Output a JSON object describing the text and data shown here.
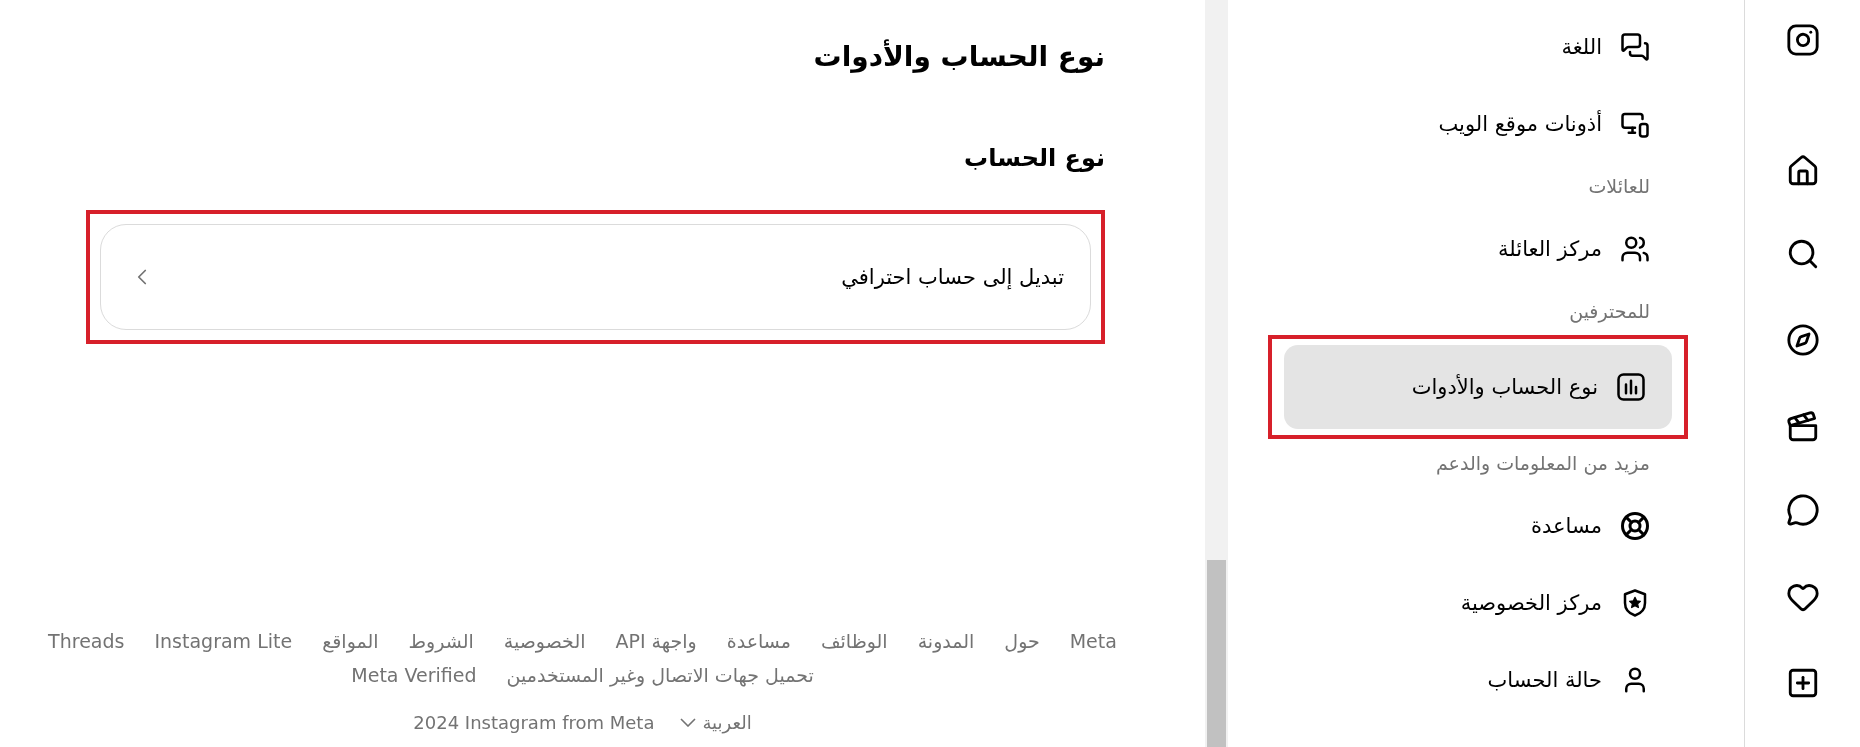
{
  "main": {
    "title": "نوع الحساب والأدوات",
    "section_title": "نوع الحساب",
    "option": {
      "label": "تبديل إلى حساب احترافي",
      "highlighted": true
    }
  },
  "footer": {
    "links": [
      "Meta",
      "حول",
      "المدونة",
      "الوظائف",
      "مساعدة",
      "واجهة API",
      "الخصوصية",
      "الشروط",
      "المواقع",
      "Instagram Lite",
      "Threads"
    ],
    "links_2": [
      "تحميل جهات الاتصال وغير المستخدمين",
      "Meta Verified"
    ],
    "language": "العربية",
    "copyright": "2024 Instagram from Meta"
  },
  "settings_menu": {
    "items": [
      {
        "kind": "item",
        "label": "اللغة",
        "selected": false,
        "highlighted": false
      },
      {
        "kind": "item",
        "label": "أذونات موقع الويب",
        "selected": false,
        "highlighted": false
      },
      {
        "kind": "section",
        "label": "للعائلات"
      },
      {
        "kind": "item",
        "label": "مركز العائلة",
        "selected": false,
        "highlighted": false
      },
      {
        "kind": "section",
        "label": "للمحترفين"
      },
      {
        "kind": "item",
        "label": "نوع الحساب والأدوات",
        "selected": true,
        "highlighted": true
      },
      {
        "kind": "section",
        "label": "مزيد من المعلومات والدعم"
      },
      {
        "kind": "item",
        "label": "مساعدة",
        "selected": false,
        "highlighted": false
      },
      {
        "kind": "item",
        "label": "مركز الخصوصية",
        "selected": false,
        "highlighted": false
      },
      {
        "kind": "item",
        "label": "حالة الحساب",
        "selected": false,
        "highlighted": false
      }
    ]
  }
}
